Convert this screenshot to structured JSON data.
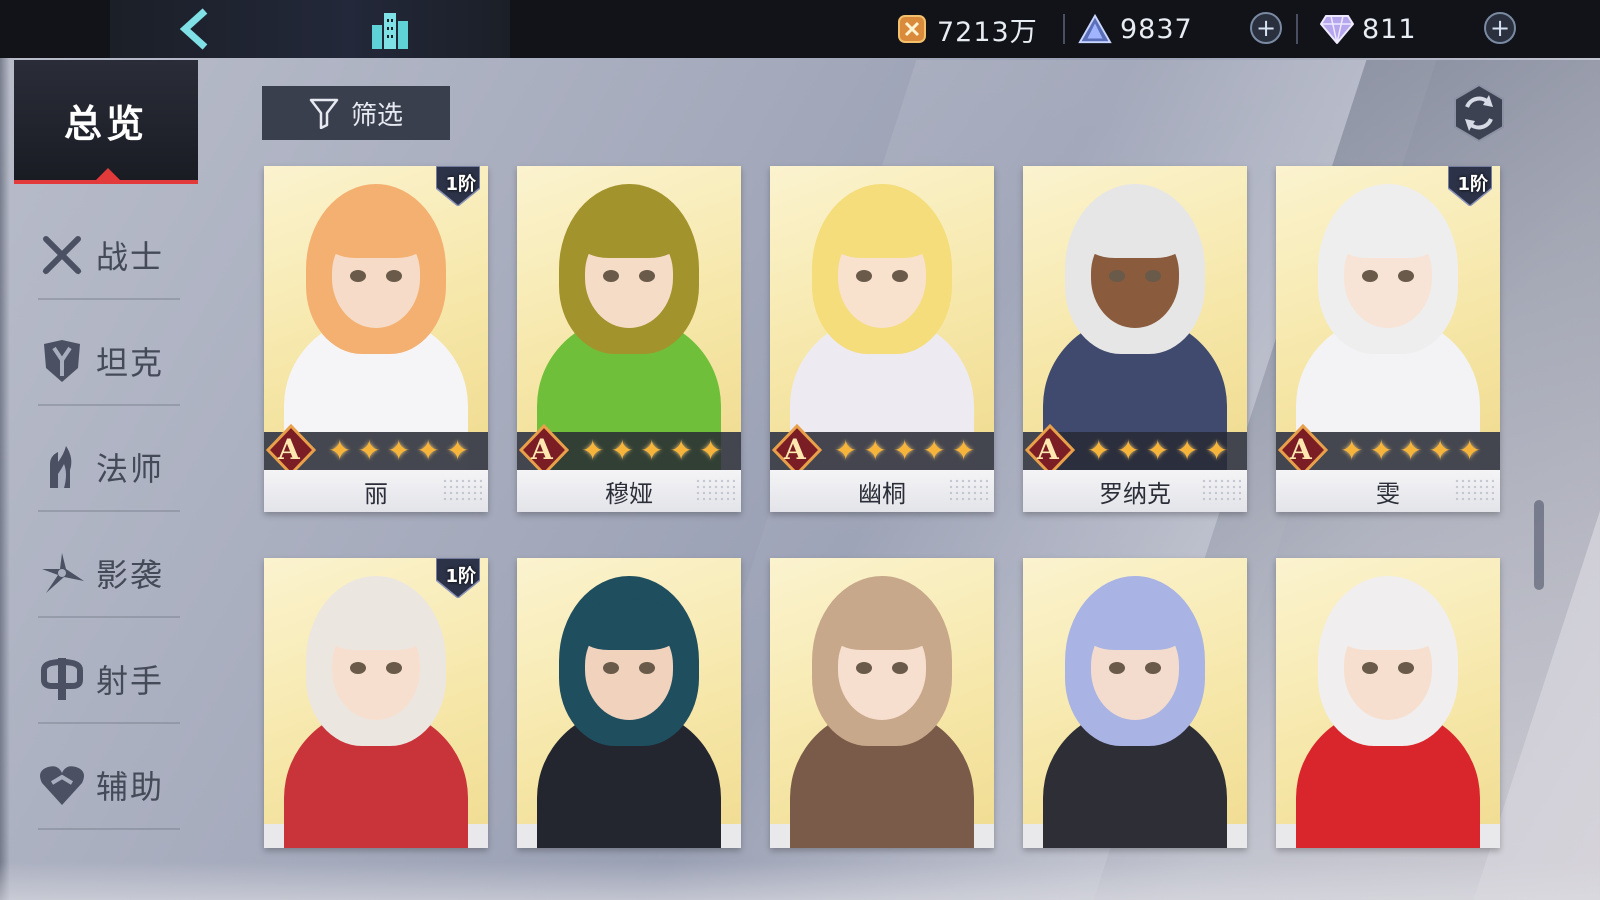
{
  "topbar": {
    "back_icon": "back-arrow-icon",
    "home_icon": "city-home-icon",
    "resources": [
      {
        "name": "gold",
        "icon": "gold-coin-icon",
        "value": "7213万"
      },
      {
        "name": "tower",
        "icon": "pyramid-token-icon",
        "value": "9837"
      },
      {
        "name": "gem",
        "icon": "diamond-icon",
        "value": "811"
      }
    ],
    "plus_label": "+"
  },
  "sidebar": {
    "overview": "总览",
    "items": [
      {
        "label": "战士",
        "icon": "crossed-swords-icon"
      },
      {
        "label": "坦克",
        "icon": "shield-icon"
      },
      {
        "label": "法师",
        "icon": "flame-staff-icon"
      },
      {
        "label": "影袭",
        "icon": "shuriken-icon"
      },
      {
        "label": "射手",
        "icon": "bow-crosshair-icon"
      },
      {
        "label": "辅助",
        "icon": "heart-icon"
      }
    ]
  },
  "toolbar": {
    "filter_label": "筛选",
    "filter_icon": "funnel-icon",
    "sort_icon": "refresh-cycle-icon"
  },
  "cards": [
    {
      "name": "丽",
      "grade": "A",
      "stars": 5,
      "rank": "1阶",
      "hair": "#f4b070",
      "skin": "#f6dcc8",
      "outfit": "#f5f5f7",
      "bg": "#ece8e2"
    },
    {
      "name": "穆娅",
      "grade": "A",
      "stars": 5,
      "rank": "",
      "hair": "#a3932c",
      "skin": "#f5dcc6",
      "outfit": "#6fbf3a",
      "bg": "#ece6cf"
    },
    {
      "name": "幽桐",
      "grade": "A",
      "stars": 5,
      "rank": "",
      "hair": "#f4dd7a",
      "skin": "#f8e1cd",
      "outfit": "#eeeaf2",
      "bg": "#f7ecc0"
    },
    {
      "name": "罗纳克",
      "grade": "A",
      "stars": 5,
      "rank": "",
      "hair": "#e6e6e6",
      "skin": "#8a5b3c",
      "outfit": "#3f4a6e",
      "bg": "#f3e6b8"
    },
    {
      "name": "雯",
      "grade": "A",
      "stars": 5,
      "rank": "1阶",
      "hair": "#eeeeef",
      "skin": "#f7e4d6",
      "outfit": "#f3f3f5",
      "bg": "#e8e7ea"
    },
    {
      "name": "",
      "grade": "",
      "stars": 0,
      "rank": "1阶",
      "hair": "#ece6e0",
      "skin": "#f7dfcf",
      "outfit": "#c8343a",
      "bg": "#f3e4c7"
    },
    {
      "name": "",
      "grade": "",
      "stars": 0,
      "rank": "",
      "hair": "#1f4e5e",
      "skin": "#f0d2bd",
      "outfit": "#23262f",
      "bg": "#f4e8b6"
    },
    {
      "name": "",
      "grade": "",
      "stars": 0,
      "rank": "",
      "hair": "#c8a88a",
      "skin": "#f7dfcf",
      "outfit": "#7a5a48",
      "bg": "#f2e6bd"
    },
    {
      "name": "",
      "grade": "",
      "stars": 0,
      "rank": "",
      "hair": "#a9b3e4",
      "skin": "#f3dccd",
      "outfit": "#2e2f36",
      "bg": "#f2e6bd"
    },
    {
      "name": "",
      "grade": "",
      "stars": 0,
      "rank": "",
      "hair": "#f0eeee",
      "skin": "#f7dfcf",
      "outfit": "#d8262c",
      "bg": "#f3e2b7"
    }
  ]
}
